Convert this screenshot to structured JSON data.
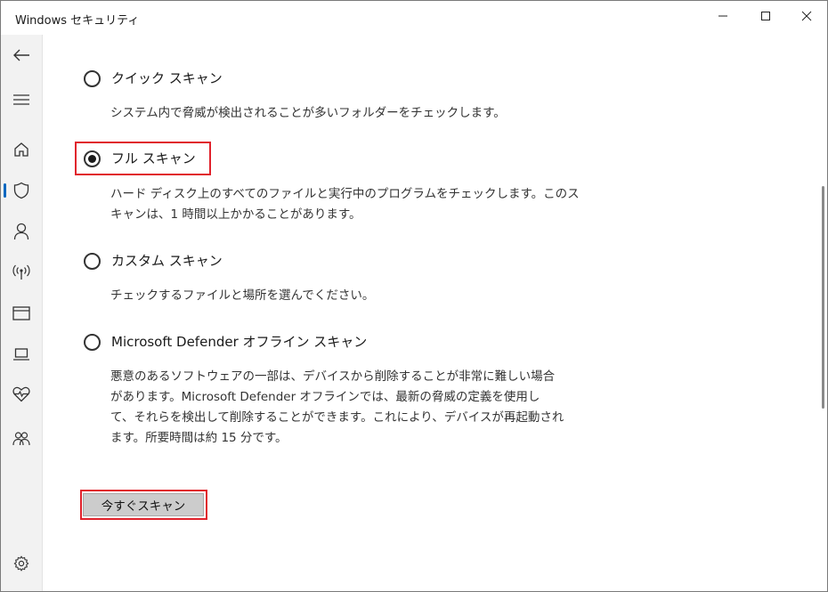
{
  "window": {
    "title": "Windows セキュリティ"
  },
  "sidebar": {
    "items": [
      {
        "icon": "back-arrow-icon"
      },
      {
        "icon": "hamburger-menu-icon"
      },
      {
        "icon": "home-icon"
      },
      {
        "icon": "shield-icon",
        "active": true
      },
      {
        "icon": "person-icon"
      },
      {
        "icon": "wireless-icon"
      },
      {
        "icon": "app-browser-icon"
      },
      {
        "icon": "laptop-icon"
      },
      {
        "icon": "heart-pulse-icon"
      },
      {
        "icon": "family-icon"
      },
      {
        "icon": "gear-icon"
      }
    ]
  },
  "scan_options": {
    "quick": {
      "label": "クイック スキャン",
      "description": "システム内で脅威が検出されることが多いフォルダーをチェックします。",
      "selected": false
    },
    "full": {
      "label": "フル スキャン",
      "description_line1": "ハード ディスク上のすべてのファイルと実行中のプログラムをチェックします。このス",
      "description_line2": "キャンは、1 時間以上かかることがあります。",
      "selected": true
    },
    "custom": {
      "label": "カスタム スキャン",
      "description": "チェックするファイルと場所を選んでください。",
      "selected": false
    },
    "offline": {
      "label": "Microsoft Defender オフライン スキャン",
      "description_line1": "悪意のあるソフトウェアの一部は、デバイスから削除することが非常に難しい場合",
      "description_line2": "があります。Microsoft Defender オフラインでは、最新の脅威の定義を使用し",
      "description_line3": "て、それらを検出して削除することができます。これにより、デバイスが再起動され",
      "description_line4": "ます。所要時間は約 15 分です。",
      "selected": false
    }
  },
  "actions": {
    "scan_now_label": "今すぐスキャン"
  },
  "colors": {
    "highlight": "#e0222c",
    "accent": "#0067c0"
  }
}
